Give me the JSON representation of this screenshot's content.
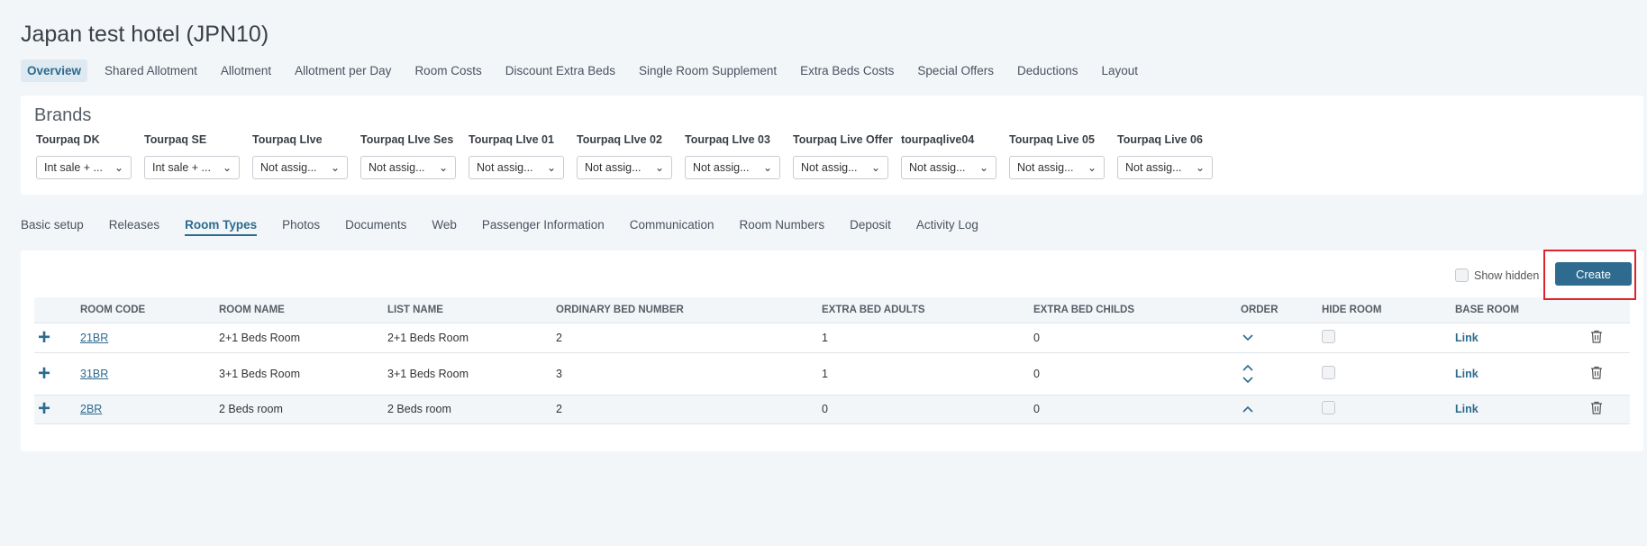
{
  "page": {
    "title": "Japan test hotel (JPN10)"
  },
  "top_tabs": [
    "Overview",
    "Shared Allotment",
    "Allotment",
    "Allotment per Day",
    "Room Costs",
    "Discount Extra Beds",
    "Single Room Supplement",
    "Extra Beds Costs",
    "Special Offers",
    "Deductions",
    "Layout"
  ],
  "brands": {
    "title": "Brands",
    "items": [
      {
        "label": "Tourpaq DK",
        "value": "Int sale + ..."
      },
      {
        "label": "Tourpaq SE",
        "value": "Int sale + ..."
      },
      {
        "label": "Tourpaq LIve",
        "value": "Not assig..."
      },
      {
        "label": "Tourpaq LIve Ses",
        "value": "Not assig..."
      },
      {
        "label": "Tourpaq LIve 01",
        "value": "Not assig..."
      },
      {
        "label": "Tourpaq LIve 02",
        "value": "Not assig..."
      },
      {
        "label": "Tourpaq LIve 03",
        "value": "Not assig..."
      },
      {
        "label": "Tourpaq Live Offer",
        "value": "Not assig..."
      },
      {
        "label": "tourpaqlive04",
        "value": "Not assig..."
      },
      {
        "label": "Tourpaq Live 05",
        "value": "Not assig..."
      },
      {
        "label": "Tourpaq Live 06",
        "value": "Not assig..."
      }
    ]
  },
  "sub_tabs": [
    "Basic setup",
    "Releases",
    "Room Types",
    "Photos",
    "Documents",
    "Web",
    "Passenger Information",
    "Communication",
    "Room Numbers",
    "Deposit",
    "Activity Log"
  ],
  "toolbar": {
    "show_hidden_label": "Show hidden",
    "create_label": "Create"
  },
  "table": {
    "headers": [
      "ROOM CODE",
      "ROOM NAME",
      "LIST NAME",
      "ORDINARY BED NUMBER",
      "EXTRA BED ADULTS",
      "EXTRA BED CHILDS",
      "ORDER",
      "HIDE ROOM",
      "BASE ROOM"
    ],
    "rows": [
      {
        "code": "21BR",
        "name": "2+1 Beds Room",
        "list_name": "2+1 Beds Room",
        "ordinary_beds": "2",
        "extra_adults": "1",
        "extra_childs": "0",
        "base_room": "Link"
      },
      {
        "code": "31BR",
        "name": "3+1 Beds Room",
        "list_name": "3+1 Beds Room",
        "ordinary_beds": "3",
        "extra_adults": "1",
        "extra_childs": "0",
        "base_room": "Link"
      },
      {
        "code": "2BR",
        "name": "2 Beds room",
        "list_name": "2 Beds room",
        "ordinary_beds": "2",
        "extra_adults": "0",
        "extra_childs": "0",
        "base_room": "Link"
      }
    ]
  },
  "colors": {
    "accent": "#2c6b8f",
    "button": "#2f6b8f",
    "highlight": "#e0232d",
    "background": "#f3f6f9"
  }
}
